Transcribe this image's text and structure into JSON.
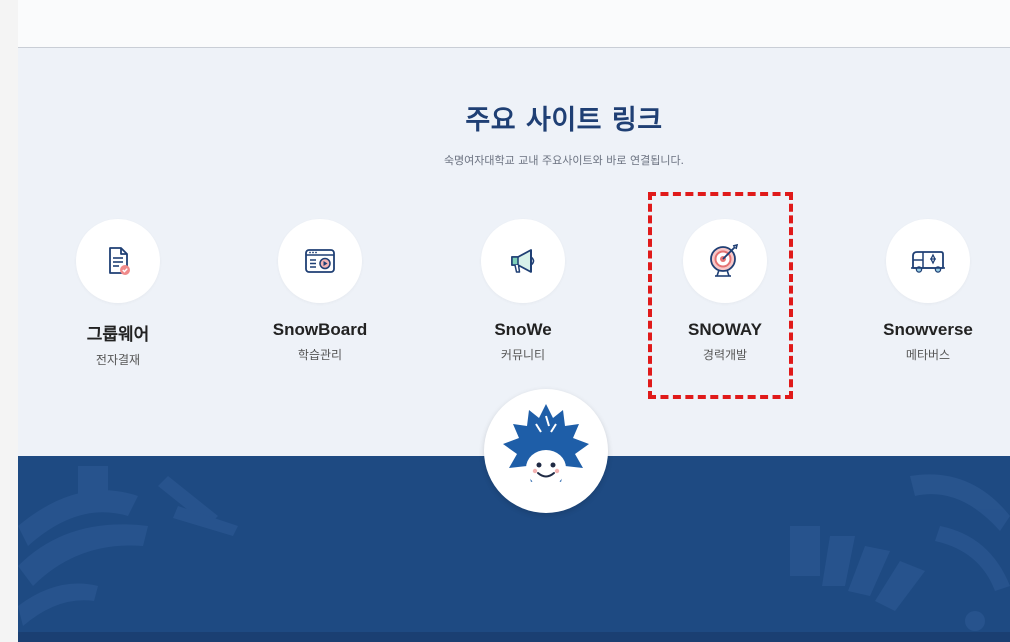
{
  "section": {
    "title": "주요 사이트 링크",
    "subtitle": "숙명여자대학교 교내 주요사이트와 바로 연결됩니다."
  },
  "sites": [
    {
      "name": "그룹웨어",
      "sub": "전자결재",
      "icon": "document-check-icon"
    },
    {
      "name": "SnowBoard",
      "sub": "학습관리",
      "icon": "video-board-icon"
    },
    {
      "name": "SnoWe",
      "sub": "커뮤니티",
      "icon": "megaphone-icon"
    },
    {
      "name": "SNOWAY",
      "sub": "경력개발",
      "icon": "target-icon"
    },
    {
      "name": "Snowverse",
      "sub": "메타버스",
      "icon": "metaverse-van-icon"
    }
  ],
  "colors": {
    "title": "#1f3f74",
    "band": "#1e4a82",
    "highlight": "#e01a1a",
    "accent_pink": "#f08a8a"
  }
}
